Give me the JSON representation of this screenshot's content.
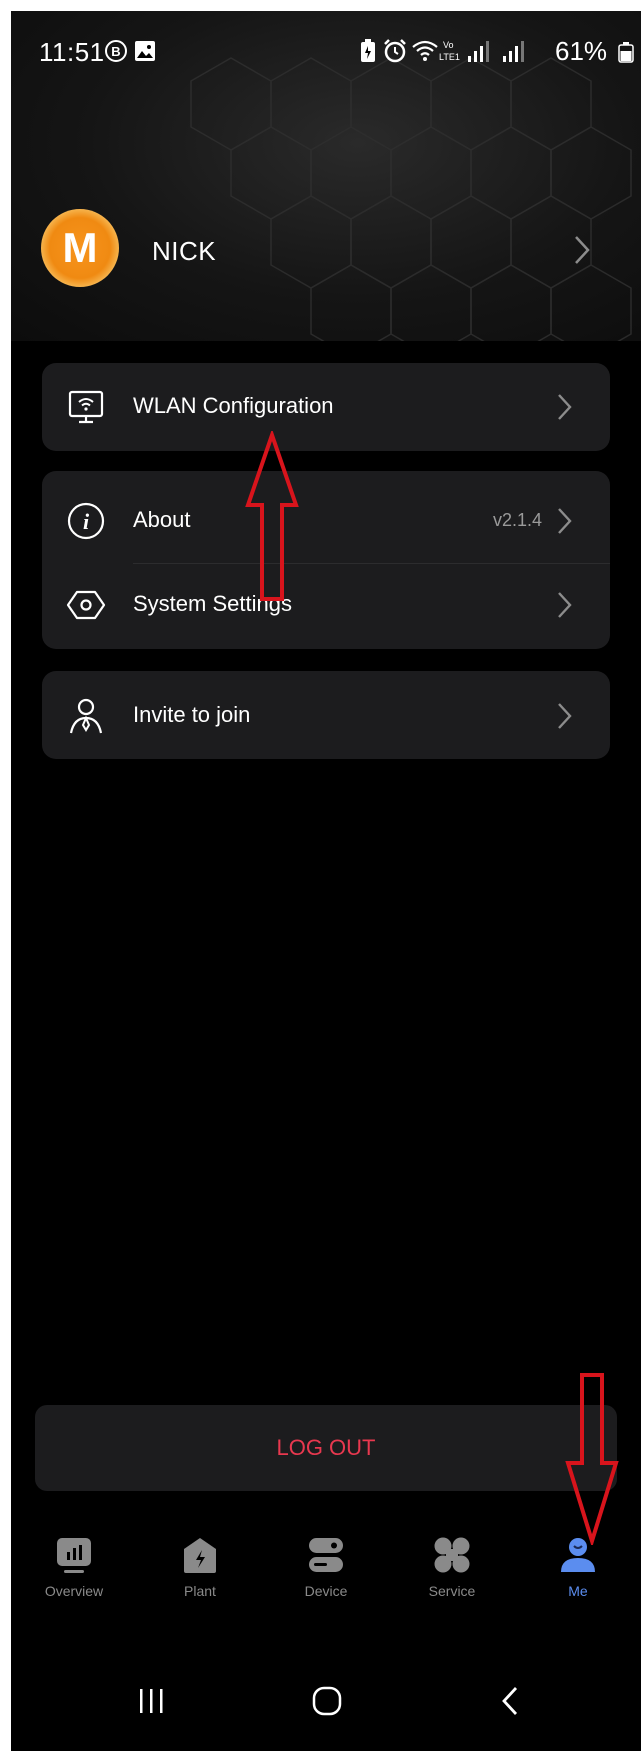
{
  "status_bar": {
    "time": "11:51",
    "battery": "61%",
    "icons": [
      "b-circle-icon",
      "image-icon",
      "battery-saver-icon",
      "alarm-icon",
      "wifi-icon",
      "volte-icon",
      "signal-icon",
      "signal-icon",
      "battery-icon"
    ]
  },
  "profile": {
    "avatar_letter": "M",
    "name": "NICK"
  },
  "menu": {
    "wlan_label": "WLAN Configuration",
    "about_label": "About",
    "about_version": "v2.1.4",
    "system_settings_label": "System Settings",
    "invite_label": "Invite to join"
  },
  "logout_label": "LOG OUT",
  "tabs": [
    {
      "label": "Overview",
      "icon": "chart-icon",
      "active": false
    },
    {
      "label": "Plant",
      "icon": "plant-icon",
      "active": false
    },
    {
      "label": "Device",
      "icon": "device-icon",
      "active": false
    },
    {
      "label": "Service",
      "icon": "service-icon",
      "active": false
    },
    {
      "label": "Me",
      "icon": "person-icon",
      "active": true
    }
  ],
  "colors": {
    "background": "#000000",
    "card": "#1c1c1e",
    "accent": "#5b8def",
    "logout": "#e8384f",
    "annotation_arrow": "#d8141c"
  }
}
